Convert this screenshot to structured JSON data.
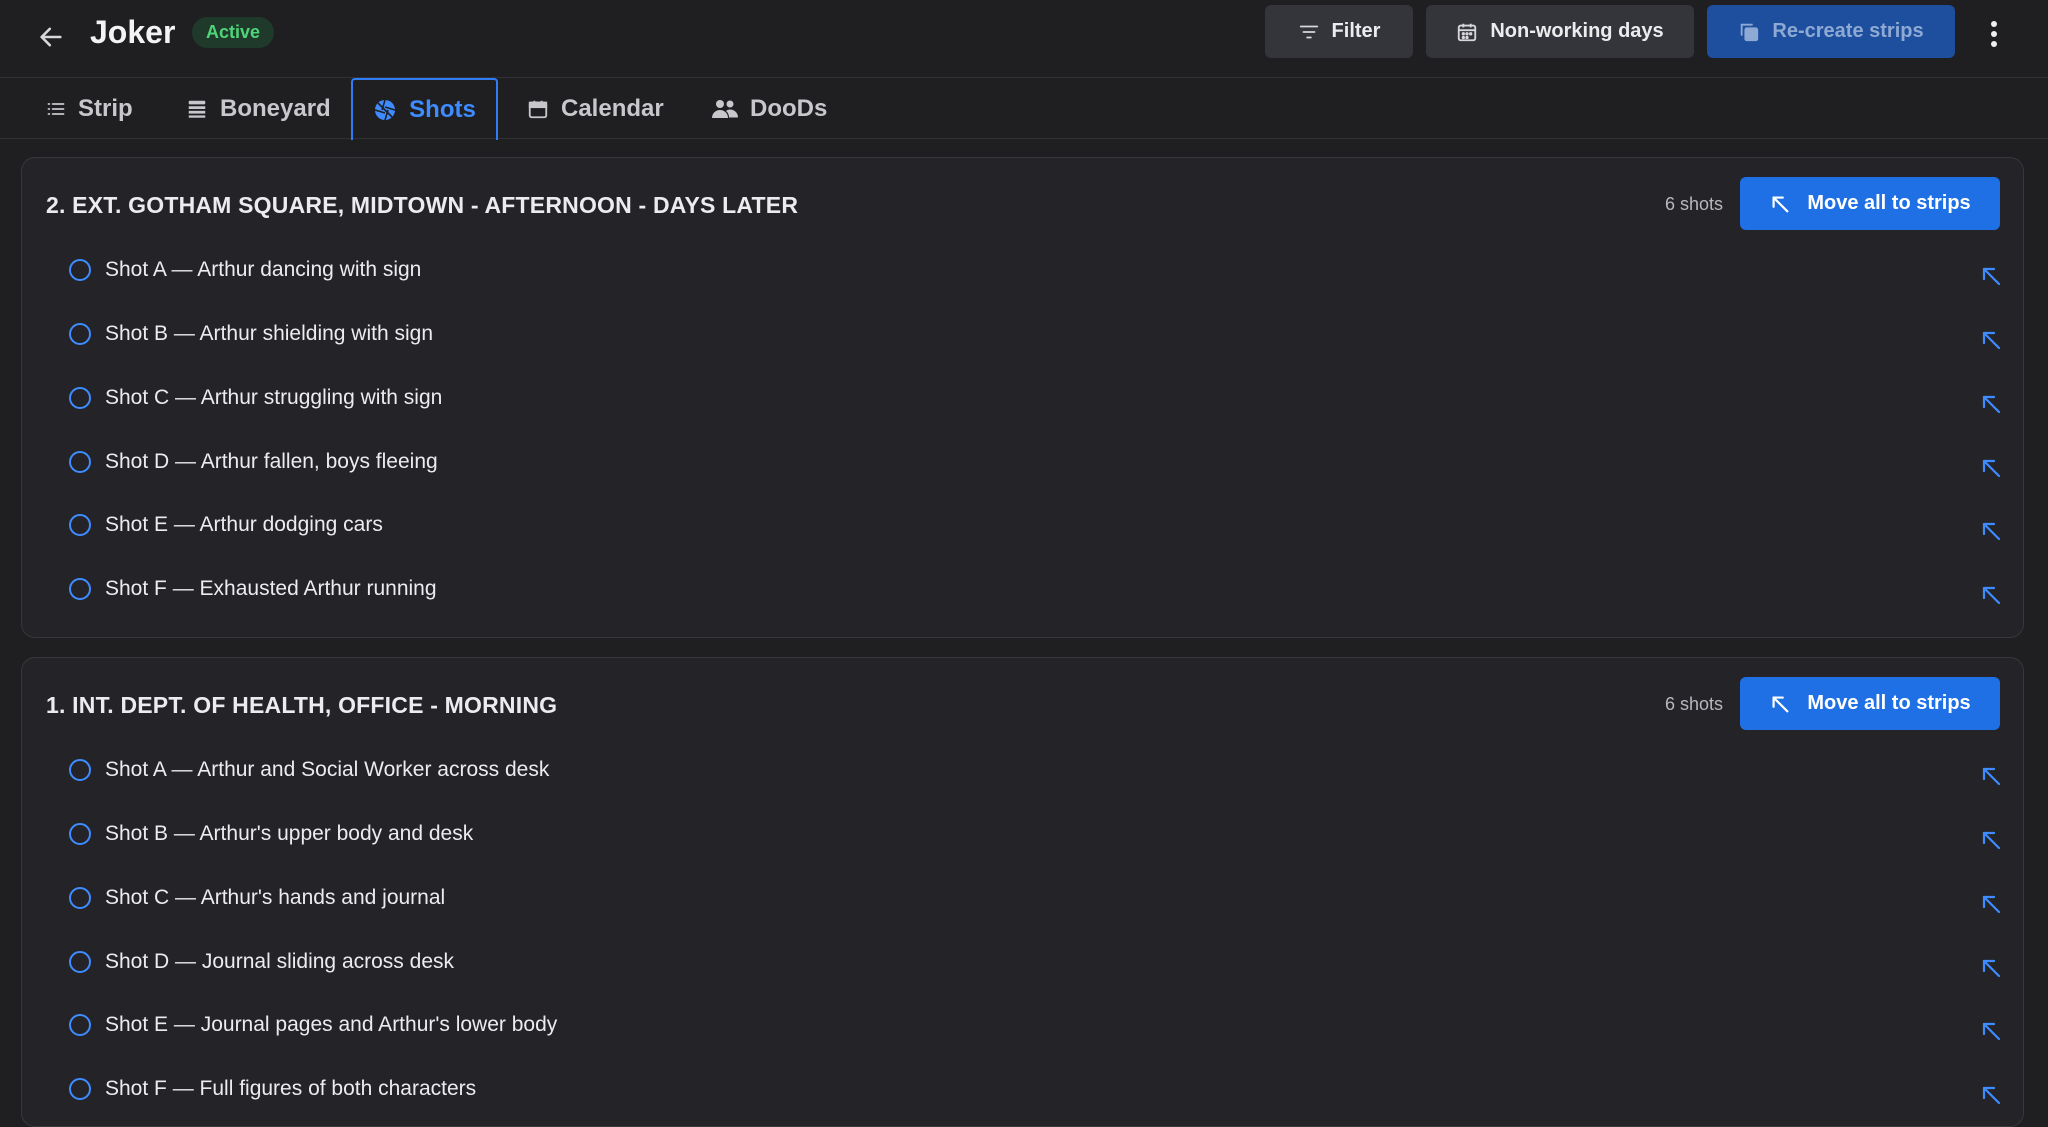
{
  "header": {
    "title": "Joker",
    "status": "Active",
    "filter_label": "Filter",
    "nonworking_label": "Non-working days",
    "recreate_label": "Re-create strips"
  },
  "tabs": [
    {
      "label": "Strip",
      "icon": "list-icon",
      "active": false
    },
    {
      "label": "Boneyard",
      "icon": "stack-icon",
      "active": false
    },
    {
      "label": "Shots",
      "icon": "aperture-icon",
      "active": true
    },
    {
      "label": "Calendar",
      "icon": "calendar-icon",
      "active": false
    },
    {
      "label": "DooDs",
      "icon": "people-icon",
      "active": false
    }
  ],
  "scenes": [
    {
      "title": "2. EXT. GOTHAM SQUARE, MIDTOWN - AFTERNOON - DAYS LATER",
      "count": "6 shots",
      "move_label": "Move all to strips",
      "shots": [
        "Shot A — Arthur dancing with sign",
        "Shot B — Arthur shielding with sign",
        "Shot C — Arthur struggling with sign",
        "Shot D — Arthur fallen, boys fleeing",
        "Shot E — Arthur dodging cars",
        "Shot F — Exhausted Arthur running"
      ]
    },
    {
      "title": "1. INT. DEPT. OF HEALTH, OFFICE - MORNING",
      "count": "6 shots",
      "move_label": "Move all to strips",
      "shots": [
        "Shot A — Arthur and Social Worker across desk",
        "Shot B — Arthur's upper body and desk",
        "Shot C — Arthur's hands and journal",
        "Shot D — Journal sliding across desk",
        "Shot E — Journal pages and Arthur's lower body",
        "Shot F — Full figures of both characters"
      ]
    }
  ],
  "colors": {
    "accent": "#2f7df6",
    "background": "#1f1f22",
    "card": "#242428",
    "status_green": "#4fd47a"
  }
}
